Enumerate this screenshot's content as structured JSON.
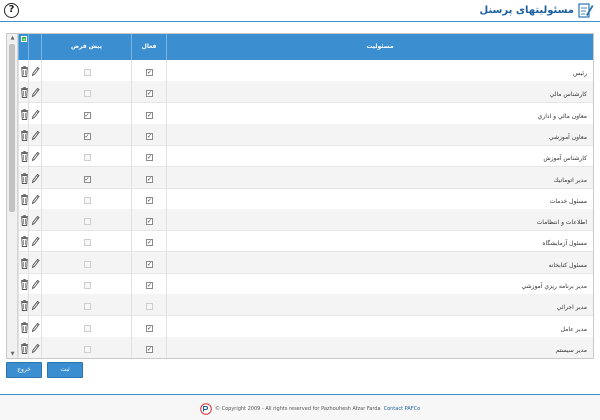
{
  "header": {
    "title": "مسئولیتهای پرسنل",
    "help_icon_text": "?"
  },
  "table": {
    "columns": {
      "select_all": "",
      "edit": "",
      "default": "پیش فرض",
      "active": "فعال",
      "responsibility": "مسئولیت"
    },
    "rows": [
      {
        "responsibility": "رئیس",
        "active": true,
        "default": false
      },
      {
        "responsibility": "کارشناس مالي",
        "active": true,
        "default": false
      },
      {
        "responsibility": "معاون مالي و اداري",
        "active": true,
        "default": true
      },
      {
        "responsibility": "معاون آموزشي",
        "active": true,
        "default": true
      },
      {
        "responsibility": "کارشناس آموزش",
        "active": true,
        "default": false
      },
      {
        "responsibility": "مدير اتوماتيك",
        "active": true,
        "default": true
      },
      {
        "responsibility": "مسئول خدمات",
        "active": true,
        "default": false
      },
      {
        "responsibility": "اطلاعات و انتظامات",
        "active": true,
        "default": false
      },
      {
        "responsibility": "مسئول آزمايشگاه",
        "active": true,
        "default": false
      },
      {
        "responsibility": "مسئول كتابخانه",
        "active": true,
        "default": false
      },
      {
        "responsibility": "مدير برنامه ريزي آموزشي",
        "active": true,
        "default": false
      },
      {
        "responsibility": "مدير اجرائي",
        "active": false,
        "default": false
      },
      {
        "responsibility": "مدير عامل",
        "active": true,
        "default": false
      },
      {
        "responsibility": "مدير سيستم",
        "active": true,
        "default": false
      }
    ]
  },
  "buttons": {
    "exit_label": "خروج",
    "save_label": "ثبت"
  },
  "footer": {
    "copyright": "© Copyright 2009 - All rights reserved for Pazhouhesh Afzar Farda",
    "contact": "Contact PAFCo"
  },
  "colors": {
    "accent": "#3b8ed0",
    "title": "#1a5f9e"
  },
  "icons": {
    "help": "question-circle-icon",
    "logo": "note-edit-icon",
    "delete": "trash-icon",
    "edit": "pencil-icon",
    "footer_logo": "pafco-logo-icon"
  }
}
